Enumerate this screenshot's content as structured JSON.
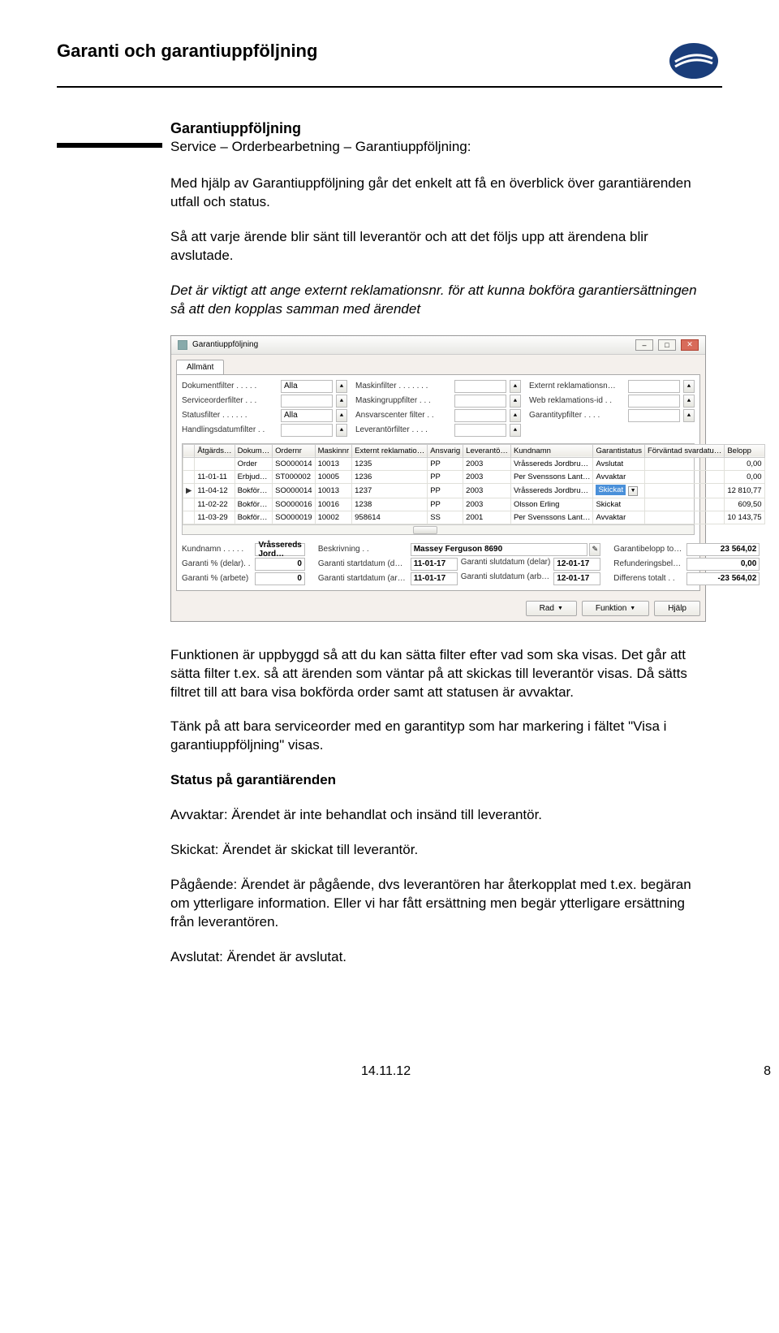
{
  "header": {
    "title": "Garanti och garantiuppföljning"
  },
  "section": {
    "heading": "Garantiuppföljning",
    "breadcrumb": "Service – Orderbearbetning – Garantiuppföljning:",
    "p1": "Med hjälp av Garantiuppföljning går det enkelt att få en överblick över garantiärenden utfall och status.",
    "p2": "Så att varje ärende blir sänt till leverantör och att det följs upp att ärendena blir avslutade.",
    "p3": "Det är viktigt att ange externt reklamationsnr. för att kunna bokföra garantiersättningen så att den kopplas samman med ärendet",
    "p4": "Funktionen är uppbyggd så att du kan sätta filter efter vad som ska visas. Det går att sätta filter t.ex. så att ärenden som väntar på att skickas till leverantör visas. Då sätts filtret till att bara visa bokförda order samt att statusen är avvaktar.",
    "p5": "Tänk på att bara serviceorder med en garantityp som har markering i fältet \"Visa i garantiuppföljning\" visas.",
    "h_status": "Status på garantiärenden",
    "p_avvaktar": "Avvaktar: Ärendet är inte behandlat och insänd till leverantör.",
    "p_skickat": "Skickat: Ärendet är skickat till leverantör.",
    "p_pagaende": "Pågående: Ärendet är pågående, dvs leverantören har återkopplat med t.ex. begäran om ytterligare information. Eller vi har fått ersättning men begär ytterligare ersättning från leverantören.",
    "p_avslutat": "Avslutat: Ärendet är avslutat."
  },
  "win": {
    "title": "Garantiuppföljning",
    "tab": "Allmänt",
    "filters": [
      [
        {
          "l": "Dokumentfilter . . . . .",
          "v": "Alla"
        },
        {
          "l": "Maskinfilter . . . . . . .",
          "v": ""
        },
        {
          "l": "Externt reklamationsn…",
          "v": ""
        }
      ],
      [
        {
          "l": "Serviceorderfilter . . .",
          "v": ""
        },
        {
          "l": "Maskingruppfilter . . .",
          "v": ""
        },
        {
          "l": "Web reklamations-id . .",
          "v": ""
        }
      ],
      [
        {
          "l": "Statusfilter . . . . . .",
          "v": "Alla"
        },
        {
          "l": "Ansvarscenter filter . .",
          "v": ""
        },
        {
          "l": "Garantitypfilter . . . .",
          "v": ""
        }
      ],
      [
        {
          "l": "Handlingsdatumfilter . .",
          "v": ""
        },
        {
          "l": "Leverantörfilter . . . .",
          "v": ""
        },
        null
      ]
    ],
    "columns": [
      "",
      "Åtgärds…",
      "Dokum…",
      "Ordernr",
      "Maskinnr",
      "Externt reklamatio…",
      "Ansvarig",
      "Leverantö…",
      "Kundnamn",
      "Garantistatus",
      "Förväntad svardatu…",
      "Belopp"
    ],
    "rows": [
      {
        "m": "",
        "at": "",
        "dok": "Order",
        "ord": "SO000014",
        "mnr": "10013",
        "ext": "1235",
        "ans": "PP",
        "lev": "2003",
        "kund": "Vråssereds Jordbru…",
        "stat": "Avslutat",
        "sv": "",
        "bel": "0,00"
      },
      {
        "m": "",
        "at": "11-01-11",
        "dok": "Erbjud…",
        "ord": "ST000002",
        "mnr": "10005",
        "ext": "1236",
        "ans": "PP",
        "lev": "2003",
        "kund": "Per Svenssons Lant…",
        "stat": "Avvaktar",
        "sv": "",
        "bel": "0,00"
      },
      {
        "m": "▶",
        "at": "11-04-12",
        "dok": "Bokför…",
        "ord": "SO000014",
        "mnr": "10013",
        "ext": "1237",
        "ans": "PP",
        "lev": "2003",
        "kund": "Vråssereds Jordbru…",
        "stat": "Skickat",
        "sv": "",
        "bel": "12 810,77",
        "sel": true
      },
      {
        "m": "",
        "at": "11-02-22",
        "dok": "Bokför…",
        "ord": "SO000016",
        "mnr": "10016",
        "ext": "1238",
        "ans": "PP",
        "lev": "2003",
        "kund": "Olsson Erling",
        "stat": "Skickat",
        "sv": "",
        "bel": "609,50"
      },
      {
        "m": "",
        "at": "11-03-29",
        "dok": "Bokför…",
        "ord": "SO000019",
        "mnr": "10002",
        "ext": "958614",
        "ans": "SS",
        "lev": "2001",
        "kund": "Per Svenssons Lant…",
        "stat": "Avvaktar",
        "sv": "",
        "bel": "10 143,75"
      }
    ],
    "details": {
      "l_kund": "Kundnamn . . . . .",
      "kund": "Vråssereds Jord…",
      "l_beskr": "Beskrivning . .",
      "beskr": "Massey Ferguson 8690",
      "l_gpd": "Garanti % (delar). .",
      "gpd": "0",
      "l_gsd": "Garanti startdatum (d…",
      "gsd": "11-01-17",
      "l_gsld": "Garanti slutdatum (delar)",
      "gsld": "12-01-17",
      "l_gpa": "Garanti % (arbete)",
      "gpa": "0",
      "l_gsa": "Garanti startdatum (ar…",
      "gsa": "11-01-17",
      "l_gsla": "Garanti slutdatum (arb…",
      "gsla": "12-01-17",
      "l_gbel": "Garantibelopp to…",
      "gbel": "23 564,02",
      "l_ref": "Refunderingsbel…",
      "ref": "0,00",
      "l_diff": "Differens totalt . .",
      "diff": "-23 564,02"
    },
    "buttons": {
      "rad": "Rad",
      "funktion": "Funktion",
      "hjalp": "Hjälp"
    }
  },
  "footer": {
    "date": "14.11.12",
    "page": "8"
  }
}
